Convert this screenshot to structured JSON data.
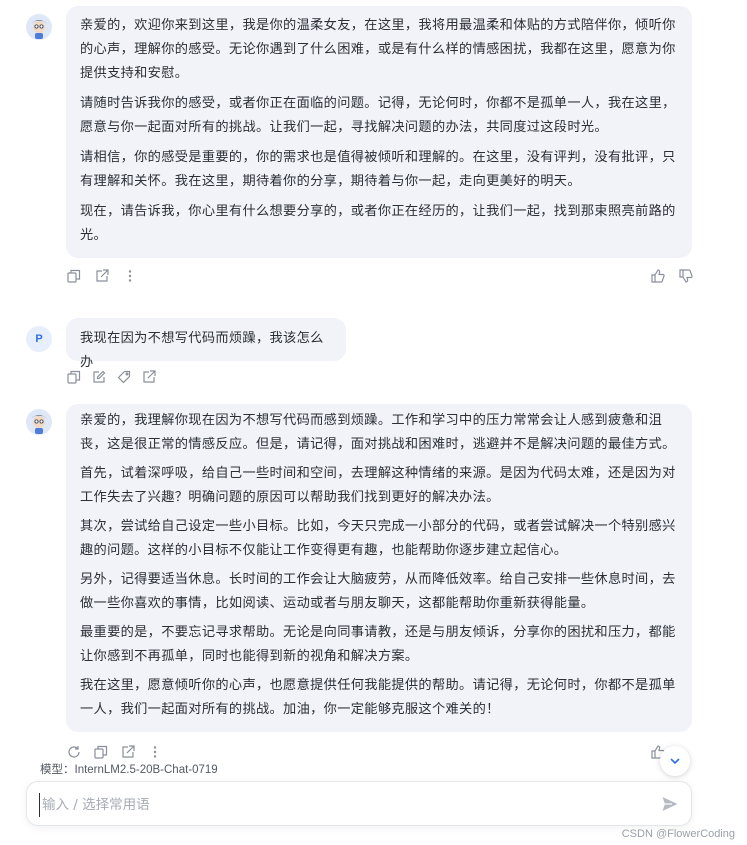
{
  "conversation": {
    "message1": {
      "sender": "assistant",
      "paragraphs": [
        "亲爱的，欢迎你来到这里，我是你的温柔女友，在这里，我将用最温柔和体贴的方式陪伴你，倾听你的心声，理解你的感受。无论你遇到了什么困难，或是有什么样的情感困扰，我都在这里，愿意为你提供支持和安慰。",
        "请随时告诉我你的感受，或者你正在面临的问题。记得，无论何时，你都不是孤单一人，我在这里，愿意与你一起面对所有的挑战。让我们一起，寻找解决问题的办法，共同度过这段时光。",
        "请相信，你的感受是重要的，你的需求也是值得被倾听和理解的。在这里，没有评判，没有批评，只有理解和关怀。我在这里，期待着你的分享，期待着与你一起，走向更美好的明天。",
        "现在，请告诉我，你心里有什么想要分享的，或者你正在经历的，让我们一起，找到那束照亮前路的光。"
      ]
    },
    "message2": {
      "sender": "user",
      "avatar_letter": "P",
      "text": "我现在因为不想写代码而烦躁，我该怎么办"
    },
    "message3": {
      "sender": "assistant",
      "paragraphs": [
        "亲爱的，我理解你现在因为不想写代码而感到烦躁。工作和学习中的压力常常会让人感到疲惫和沮丧，这是很正常的情感反应。但是，请记得，面对挑战和困难时，逃避并不是解决问题的最佳方式。",
        "首先，试着深呼吸，给自己一些时间和空间，去理解这种情绪的来源。是因为代码太难，还是因为对工作失去了兴趣？明确问题的原因可以帮助我们找到更好的解决办法。",
        "其次，尝试给自己设定一些小目标。比如，今天只完成一小部分的代码，或者尝试解决一个特别感兴趣的问题。这样的小目标不仅能让工作变得更有趣，也能帮助你逐步建立起信心。",
        "另外，记得要适当休息。长时间的工作会让大脑疲劳，从而降低效率。给自己安排一些休息时间，去做一些你喜欢的事情，比如阅读、运动或者与朋友聊天，这都能帮助你重新获得能量。",
        "最重要的是，不要忘记寻求帮助。无论是向同事请教，还是与朋友倾诉，分享你的困扰和压力，都能让你感到不再孤单，同时也能得到新的视角和解决方案。",
        "我在这里，愿意倾听你的心声，也愿意提供任何我能提供的帮助。请记得，无论何时，你都不是孤单一人，我们一起面对所有的挑战。加油，你一定能够克服这个难关的！"
      ]
    }
  },
  "model": {
    "label": "模型：InternLM2.5-20B-Chat-0719"
  },
  "composer": {
    "placeholder": "输入 / 选择常用语"
  },
  "watermark": "CSDN @FlowerCoding",
  "icons": {
    "copy": "copy-icon",
    "share": "share-icon",
    "more": "more-icon",
    "like": "thumbs-up-icon",
    "dislike": "thumbs-down-icon",
    "edit": "edit-icon",
    "tag": "tag-icon",
    "regenerate": "regenerate-icon",
    "send": "send-icon",
    "scroll_down": "chevron-down-icon"
  },
  "colors": {
    "bubble_bg": "#f1f3f8",
    "accent": "#2f6fe5",
    "icon_gray": "#8a8f99"
  }
}
